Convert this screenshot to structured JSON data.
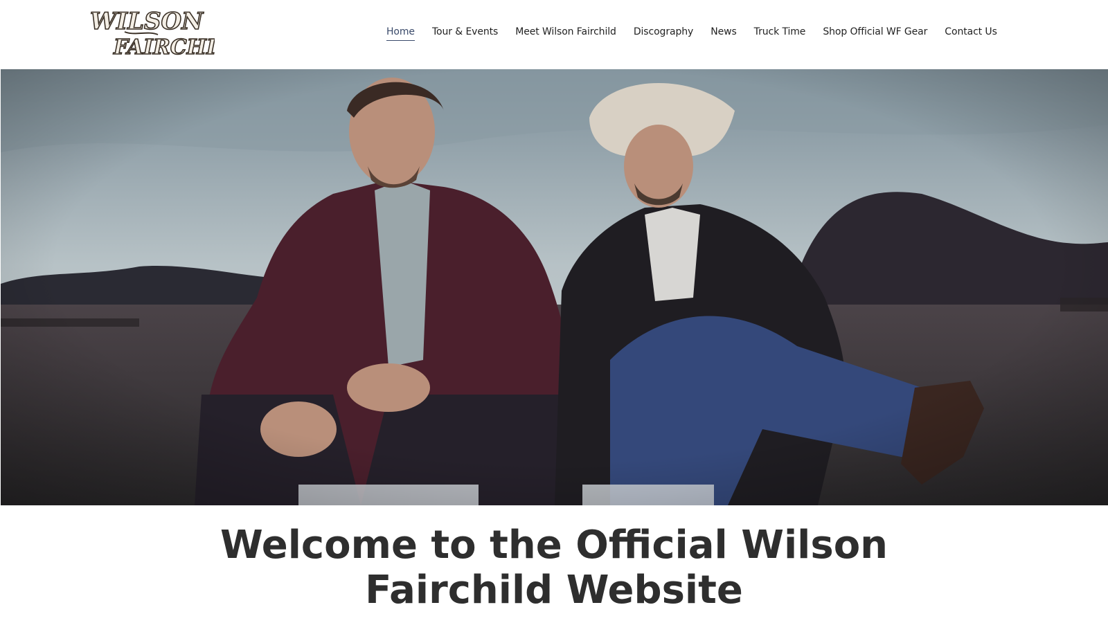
{
  "logo": {
    "line1": "WILSON",
    "line2": "FAIRCHILD"
  },
  "nav": {
    "items": [
      {
        "label": "Home",
        "active": true
      },
      {
        "label": "Tour & Events",
        "active": false
      },
      {
        "label": "Meet Wilson Fairchild",
        "active": false
      },
      {
        "label": "Discography",
        "active": false
      },
      {
        "label": "News",
        "active": false
      },
      {
        "label": "Truck Time",
        "active": false
      },
      {
        "label": "Shop Official WF Gear",
        "active": false
      },
      {
        "label": "Contact Us",
        "active": false
      }
    ]
  },
  "welcome": {
    "line1": "Welcome to the Official Wilson",
    "line2": "Fairchild Website"
  }
}
